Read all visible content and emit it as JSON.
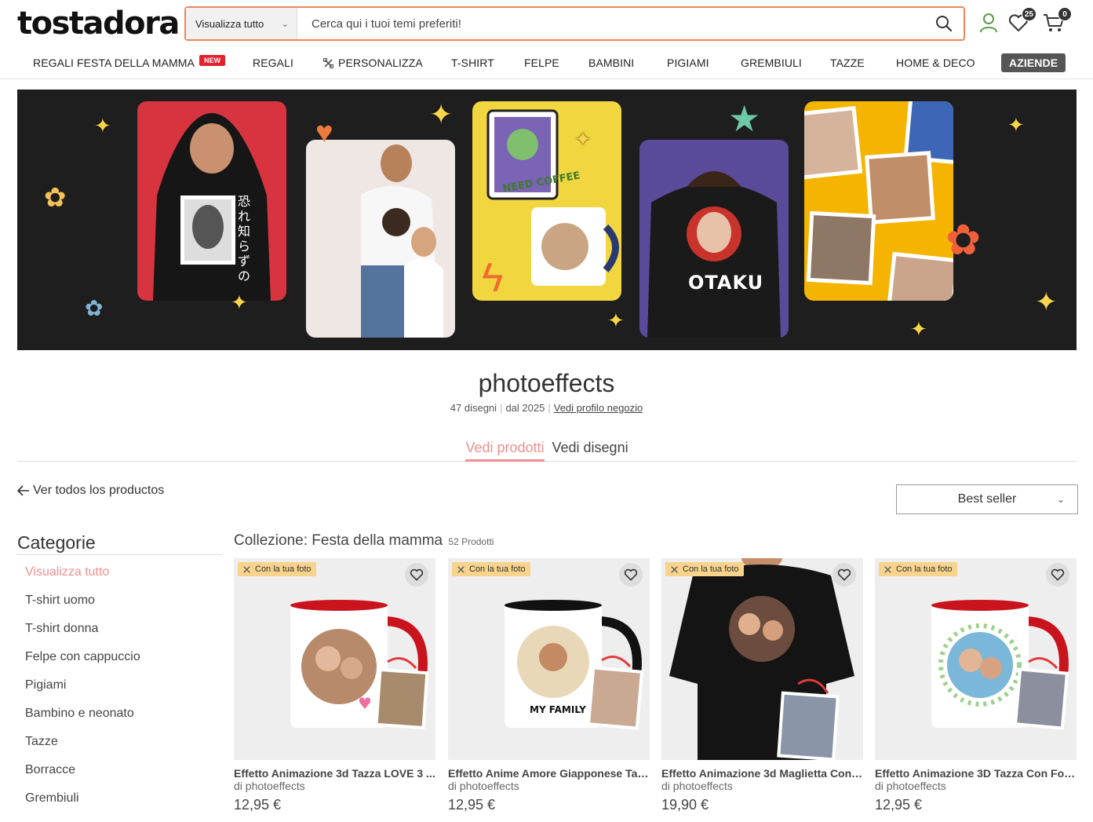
{
  "header": {
    "logo": "tostadora",
    "search_category": "Visualizza tutto",
    "search_placeholder": "Cerca qui i tuoi temi preferiti!",
    "wishlist_count": "25",
    "cart_count": "0"
  },
  "nav": {
    "items": [
      "REGALI FESTA DELLA MAMMA",
      "REGALI",
      "PERSONALIZZA",
      "T-SHIRT",
      "FELPE",
      "BAMBINI",
      "PIGIAMI",
      "GREMBIULI",
      "TAZZE",
      "HOME & DECO"
    ],
    "new_badge": "NEW",
    "aziende": "AZIENDE"
  },
  "banner": {
    "hoodie_text": "恐れ知らずの",
    "mug_text": "NEED COFFEE",
    "tshirt_text": "OTAKU"
  },
  "store": {
    "name": "photoeffects",
    "designs": "47 disegni",
    "since": "dal 2025",
    "profile_link": "Vedi profilo negozio"
  },
  "tabs": {
    "products": "Vedi prodotti",
    "designs": "Vedi disegni"
  },
  "back_link": "Ver todos los productos",
  "sort": {
    "selected": "Best seller"
  },
  "categories": {
    "title": "Categorie",
    "items": [
      "Visualizza tutto",
      "T-shirt uomo",
      "T-shirt donna",
      "Felpe con cappuccio",
      "Pigiami",
      "Bambino e neonato",
      "Tazze",
      "Borracce",
      "Grembiuli"
    ]
  },
  "collection": {
    "title": "Collezione: Festa della mamma",
    "count": "52 Prodotti"
  },
  "products": [
    {
      "tag": "Con la tua foto",
      "title": "Effetto Animazione 3d Tazza LOVE 3 ...",
      "by": "di photoeffects",
      "price": "12,95 €",
      "kind": "mug-red"
    },
    {
      "tag": "Con la tua foto",
      "title": "Effetto Anime Amore Giapponese Taz...",
      "by": "di photoeffects",
      "price": "12,95 €",
      "kind": "mug-black"
    },
    {
      "tag": "Con la tua foto",
      "title": "Effetto Animazione 3d Maglietta Con ...",
      "by": "di photoeffects",
      "price": "19,90 €",
      "kind": "tshirt"
    },
    {
      "tag": "Con la tua foto",
      "title": "Effetto Animazione 3D Tazza Con Fot...",
      "by": "di photoeffects",
      "price": "12,95 €",
      "kind": "mug-red"
    }
  ],
  "product_mug_text": "MY FAMILY"
}
